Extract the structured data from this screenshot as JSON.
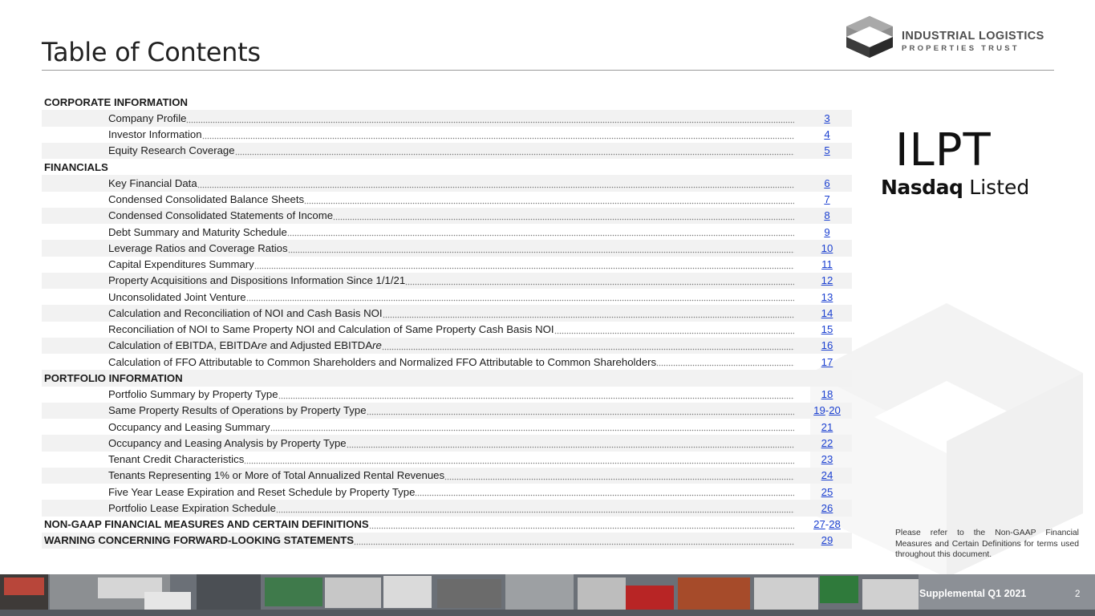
{
  "header": {
    "title": "Table of Contents",
    "logo": {
      "line1": "INDUSTRIAL LOGISTICS",
      "line2": "PROPERTIES TRUST",
      "icon": "hexagon-cube-logo"
    }
  },
  "ticker": {
    "symbol": "ILPT",
    "exchange_bold": "Nasdaq",
    "exchange_rest": " Listed"
  },
  "toc": [
    {
      "type": "section",
      "label": "CORPORATE INFORMATION",
      "shade": false
    },
    {
      "type": "item",
      "label": "Company Profile",
      "pages": [
        "3"
      ],
      "shade": true
    },
    {
      "type": "item",
      "label": "Investor Information",
      "pages": [
        "4"
      ],
      "shade": false
    },
    {
      "type": "item",
      "label": "Equity Research Coverage",
      "pages": [
        "5"
      ],
      "shade": true
    },
    {
      "type": "section",
      "label": "FINANCIALS",
      "shade": false
    },
    {
      "type": "item",
      "label": "Key Financial Data",
      "pages": [
        "6"
      ],
      "shade": true
    },
    {
      "type": "item",
      "label": "Condensed Consolidated Balance Sheets",
      "pages": [
        "7"
      ],
      "shade": false
    },
    {
      "type": "item",
      "label": "Condensed Consolidated Statements of Income",
      "pages": [
        "8"
      ],
      "shade": true
    },
    {
      "type": "item",
      "label": "Debt Summary and Maturity Schedule",
      "pages": [
        "9"
      ],
      "shade": false
    },
    {
      "type": "item",
      "label": "Leverage Ratios and Coverage Ratios",
      "pages": [
        "10"
      ],
      "shade": true
    },
    {
      "type": "item",
      "label": "Capital Expenditures Summary",
      "pages": [
        "11"
      ],
      "shade": false
    },
    {
      "type": "item",
      "label": "Property Acquisitions and Dispositions Information Since 1/1/21",
      "pages": [
        "12"
      ],
      "shade": true
    },
    {
      "type": "item",
      "label": "Unconsolidated Joint Venture",
      "pages": [
        "13"
      ],
      "shade": false
    },
    {
      "type": "item",
      "label": "Calculation and Reconciliation of NOI and Cash Basis NOI",
      "pages": [
        "14"
      ],
      "shade": true
    },
    {
      "type": "item",
      "label": "Reconciliation of NOI to Same Property NOI and Calculation of Same Property Cash Basis NOI",
      "pages": [
        "15"
      ],
      "shade": false
    },
    {
      "type": "item",
      "label": "Calculation of EBITDA, EBITDAre and Adjusted EBITDAre",
      "pages": [
        "16"
      ],
      "shade": true
    },
    {
      "type": "item",
      "label": "Calculation of FFO Attributable to Common Shareholders and Normalized FFO Attributable to Common Shareholders",
      "pages": [
        "17"
      ],
      "shade": false
    },
    {
      "type": "section",
      "label": "PORTFOLIO INFORMATION",
      "shade": true
    },
    {
      "type": "item",
      "label": "Portfolio Summary by Property Type",
      "pages": [
        "18"
      ],
      "shade": false
    },
    {
      "type": "item",
      "label": "Same Property Results of Operations by Property Type",
      "pages": [
        "19",
        "20"
      ],
      "shade": true
    },
    {
      "type": "item",
      "label": "Occupancy and Leasing Summary",
      "pages": [
        "21"
      ],
      "shade": false
    },
    {
      "type": "item",
      "label": "Occupancy and Leasing Analysis by Property Type",
      "pages": [
        "22"
      ],
      "shade": true
    },
    {
      "type": "item",
      "label": "Tenant Credit Characteristics",
      "pages": [
        "23"
      ],
      "shade": false
    },
    {
      "type": "item",
      "label": "Tenants Representing 1% or More of Total Annualized Rental Revenues",
      "pages": [
        "24"
      ],
      "shade": true
    },
    {
      "type": "item",
      "label": "Five Year Lease Expiration and Reset Schedule by Property Type",
      "pages": [
        "25"
      ],
      "shade": false
    },
    {
      "type": "item",
      "label": "Portfolio Lease Expiration Schedule",
      "pages": [
        "26"
      ],
      "shade": true
    },
    {
      "type": "section",
      "label": "NON-GAAP FINANCIAL MEASURES AND CERTAIN DEFINITIONS",
      "pages": [
        "27",
        "28"
      ],
      "shade": false
    },
    {
      "type": "section",
      "label": "WARNING CONCERNING FORWARD-LOOKING STATEMENTS",
      "pages": [
        "29"
      ],
      "shade": true
    }
  ],
  "note": "Please refer to the Non-GAAP Financial Measures and Certain Definitions for terms used throughout this document.",
  "footer": {
    "label": "Supplemental Q1 2021",
    "page_number": "2"
  },
  "colors": {
    "link": "#1a3fd0",
    "row_shade": "#f2f2f2",
    "rule": "#9a9a9a"
  }
}
